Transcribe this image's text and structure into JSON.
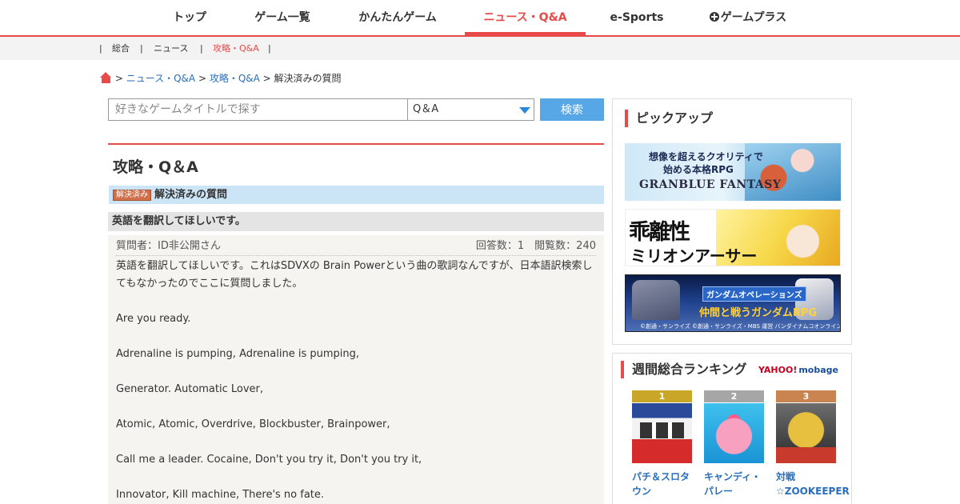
{
  "nav": {
    "items": [
      "トップ",
      "ゲーム一覧",
      "かんたんゲーム",
      "ニュース・Q&A",
      "e-Sports",
      "ゲームプラス"
    ],
    "active": "ニュース・Q&A"
  },
  "subnav": {
    "items": [
      "総合",
      "ニュース",
      "攻略・Q&A"
    ],
    "active": "攻略・Q&A"
  },
  "breadcrumb": {
    "links": [
      "ニュース・Q&A",
      "攻略・Q&A"
    ],
    "current": "解決済みの質問"
  },
  "search": {
    "placeholder": "好きなゲームタイトルで探す",
    "selected": "Q＆A",
    "button_label": "検索"
  },
  "page": {
    "title": "攻略・Q＆A",
    "solved_badge": "解決済み",
    "section_label": "解決済みの質問"
  },
  "question": {
    "title": "英語を翻訳してほしいです。",
    "asker": "質問者：ID非公開さん",
    "counts": "回答数：1　閲覧数：240",
    "lines": [
      "英語を翻訳してほしいです。これはSDVXの Brain Powerという曲の歌詞なんですが、日本語訳検索してもなかったのでここに質問しました。",
      "",
      "Are you ready.",
      "",
      "Adrenaline is pumping, Adrenaline is pumping,",
      "",
      "Generator. Automatic Lover,",
      "",
      "Atomic, Atomic, Overdrive, Blockbuster, Brainpower,",
      "",
      "Call me a leader. Cocaine, Don't you try it, Don't you try it,",
      "",
      "Innovator, Kill machine, There's no fate."
    ]
  },
  "pickup": {
    "heading": "ピックアップ",
    "banners": {
      "gbf": {
        "line1": "想像を超えるクオリティで",
        "line2": "始める本格RPG",
        "logo": "GRANBLUE FANTASY"
      },
      "million": {
        "line1": "乖離性",
        "line2": "ミリオンアーサー"
      },
      "gundam": {
        "badge": "ガンダムオペレーションズ",
        "tagline": "仲間と戦うガンダムRPG",
        "credit": "©創通・サンライズ ©創通・サンライズ・MBS 運営 バンダイナムコオンライン"
      }
    }
  },
  "ranking": {
    "heading": "週間総合ランキング",
    "logo_yahoo": "YAHOO!",
    "logo_mobage": "mobage",
    "items": [
      {
        "rank": "1",
        "title": "パチ＆スロタウン"
      },
      {
        "rank": "2",
        "title": "キャンディ・パレー"
      },
      {
        "rank": "3",
        "title": "対戦☆ZOOKEEPER"
      }
    ]
  },
  "colors": {
    "accent": "#e84a4a",
    "link": "#2a6ebb",
    "search_button": "#57a7e6",
    "section_bar": "#cce5f6"
  }
}
